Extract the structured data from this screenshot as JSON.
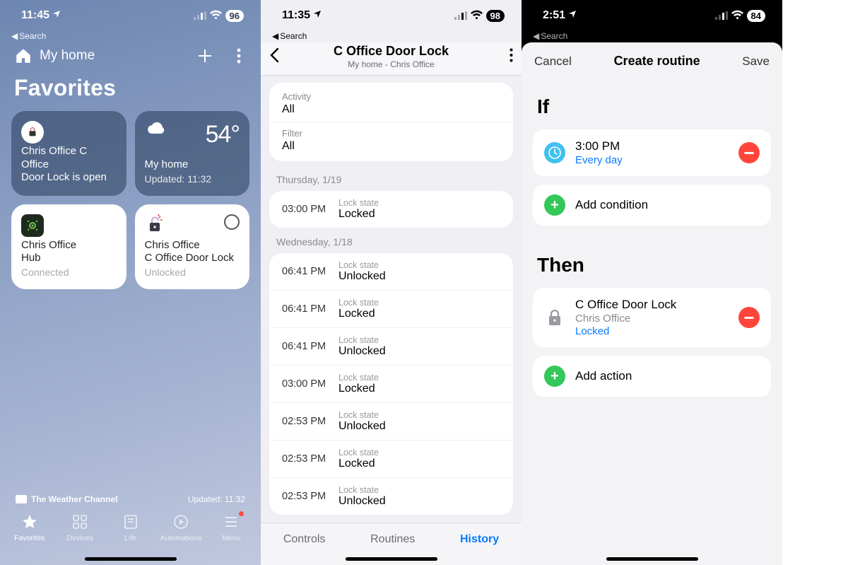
{
  "screen1": {
    "status": {
      "time": "11:45",
      "back": "Search",
      "battery": "96"
    },
    "header": {
      "home": "My home"
    },
    "title": "Favorites",
    "cards": {
      "alert": {
        "line1": "Chris Office C Office",
        "line2": "Door Lock is open"
      },
      "weather": {
        "temp": "54°",
        "line1": "My home",
        "line2": "Updated: 11:32"
      },
      "hub": {
        "line1": "Chris Office",
        "line2": "Hub",
        "status": "Connected"
      },
      "lock": {
        "line1": "Chris Office",
        "line2": "C Office Door Lock",
        "status": "Unlocked"
      }
    },
    "footer": {
      "brand": "The Weather Channel",
      "updated": "Updated: 11:32"
    },
    "tabs": {
      "favorites": "Favorites",
      "devices": "Devices",
      "life": "Life",
      "automations": "Automations",
      "menu": "Menu"
    }
  },
  "screen2": {
    "status": {
      "time": "11:35",
      "back": "Search",
      "battery": "98"
    },
    "nav": {
      "title": "C Office Door Lock",
      "subtitle": "My home - Chris Office"
    },
    "filters": {
      "activity_label": "Activity",
      "activity_value": "All",
      "filter_label": "Filter",
      "filter_value": "All"
    },
    "day1": {
      "header": "Thursday, 1/19",
      "events": [
        {
          "time": "03:00 PM",
          "label": "Lock state",
          "value": "Locked"
        }
      ]
    },
    "day2": {
      "header": "Wednesday, 1/18",
      "events": [
        {
          "time": "06:41 PM",
          "label": "Lock state",
          "value": "Unlocked"
        },
        {
          "time": "06:41 PM",
          "label": "Lock state",
          "value": "Locked"
        },
        {
          "time": "06:41 PM",
          "label": "Lock state",
          "value": "Unlocked"
        },
        {
          "time": "03:00 PM",
          "label": "Lock state",
          "value": "Locked"
        },
        {
          "time": "02:53 PM",
          "label": "Lock state",
          "value": "Unlocked"
        },
        {
          "time": "02:53 PM",
          "label": "Lock state",
          "value": "Locked"
        },
        {
          "time": "02:53 PM",
          "label": "Lock state",
          "value": "Unlocked"
        }
      ]
    },
    "tabs": {
      "controls": "Controls",
      "routines": "Routines",
      "history": "History"
    }
  },
  "screen3": {
    "status": {
      "time": "2:51",
      "back": "Search",
      "battery": "84"
    },
    "nav": {
      "cancel": "Cancel",
      "title": "Create routine",
      "save": "Save"
    },
    "if_title": "If",
    "if_time": {
      "line1": "3:00 PM",
      "line2": "Every day"
    },
    "add_condition": "Add condition",
    "then_title": "Then",
    "then_action": {
      "name": "C Office Door Lock",
      "room": "Chris Office",
      "state": "Locked"
    },
    "add_action": "Add action"
  }
}
